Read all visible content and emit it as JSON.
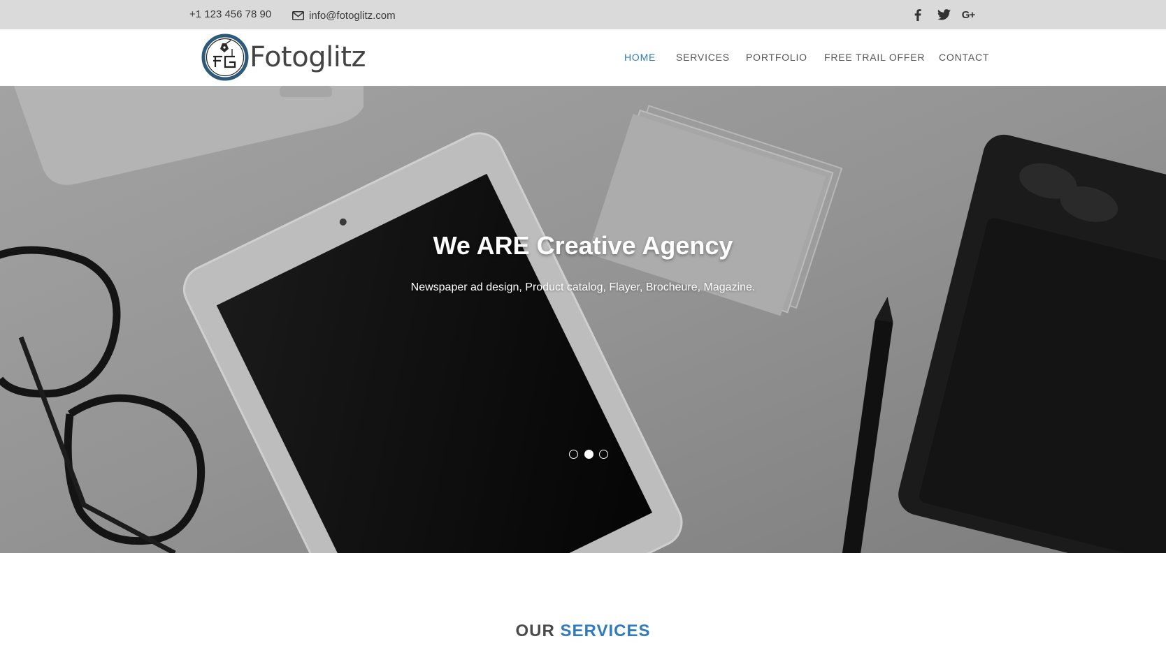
{
  "topbar": {
    "phone": "+1 123 456 78 90",
    "email": "info@fotoglitz.com",
    "social": [
      "facebook-icon",
      "twitter-icon",
      "google-plus-icon"
    ],
    "gplus_glyph": "G+"
  },
  "header": {
    "logo_text": "Fotoglitz",
    "nav": [
      "HOME",
      "SERVICES",
      "PORTFOLIO",
      "FREE TRAIL OFFER",
      "CONTACT"
    ],
    "active_nav": "HOME"
  },
  "hero": {
    "title": "We ARE Creative Agency",
    "subtitle": "Newspaper ad design, Product catalog, Flayer, Brocheure, Magazine.",
    "slides": 3,
    "active_slide": 2
  },
  "services": {
    "title_part1": "OUR",
    "title_part2": "SERVICES"
  },
  "colors": {
    "accent": "#2f7bbd",
    "topbar_bg": "#dadada",
    "text_dark": "#444444"
  }
}
